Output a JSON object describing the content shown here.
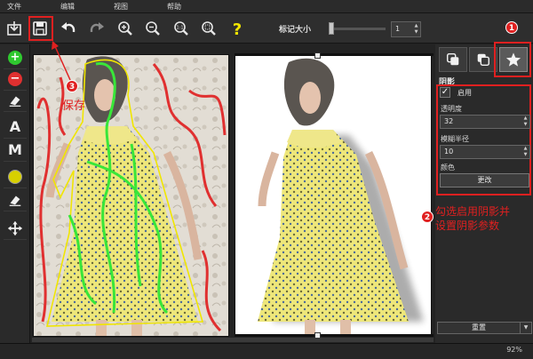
{
  "menu": [
    "文件",
    "编辑",
    "视图",
    "帮助"
  ],
  "toolbar": {
    "marker_size_label": "标记大小",
    "marker_size_value": "1",
    "icons": [
      "import-icon",
      "save-icon",
      "undo-icon",
      "redo-icon",
      "zoom-in-icon",
      "zoom-out-icon",
      "actual-size-icon",
      "fit-icon",
      "help-icon"
    ]
  },
  "left_tools": {
    "letter_a": "A",
    "letter_m": "M"
  },
  "shadow_panel": {
    "heading": "阴影",
    "enable_label": "启用",
    "enabled": true,
    "opacity_label": "透明度",
    "opacity_value": "32",
    "blur_label": "模糊半径",
    "blur_value": "10",
    "color_label": "颜色",
    "change_button": "更改"
  },
  "reset_button": "重置",
  "status": {
    "zoom": "92%"
  },
  "annotations": {
    "step1": "1",
    "step2": "2",
    "step2_line1": "勾选启用阴影并",
    "step2_line2": "设置阴影参数",
    "step3": "3",
    "step3_text": "保存"
  },
  "colors": {
    "annotation_red": "#e02020",
    "keep_green": "#39e639",
    "remove_red": "#e03030",
    "marker_yellow": "#e6e000"
  }
}
